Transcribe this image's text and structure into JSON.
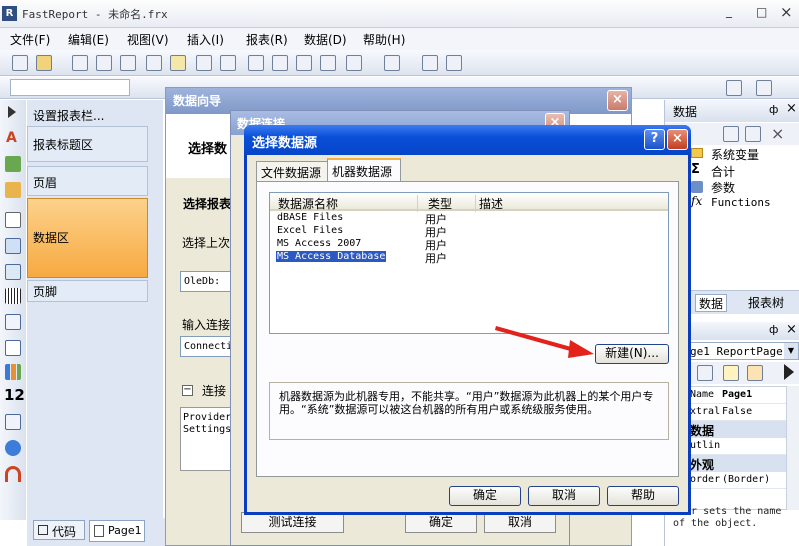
{
  "app": {
    "title": "FastReport - 未命名.frx",
    "win_min": "_",
    "win_max": "□",
    "win_close": "×"
  },
  "menu": [
    {
      "label": "文件(F)"
    },
    {
      "label": "编辑(E)"
    },
    {
      "label": "视图(V)"
    },
    {
      "label": "插入(I)"
    },
    {
      "label": "报表(R)"
    },
    {
      "label": "数据(D)"
    },
    {
      "label": "帮助(H)"
    }
  ],
  "bands": {
    "setup": "设置报表栏...",
    "items": [
      {
        "label": "报表标题区"
      },
      {
        "label": "页眉"
      },
      {
        "label": "数据区"
      },
      {
        "label": "页脚"
      }
    ]
  },
  "bottom_tabs": {
    "code": "代码",
    "page": "Page1"
  },
  "wizard": {
    "title": "数据向导",
    "heading": "选择数",
    "step_label": "选择报表",
    "upper_label": "选择上次",
    "oledb_value": "OleDb: ",
    "conn_label": "输入连接",
    "conn_value": "Connecti",
    "connect_section": "连接",
    "provider_text": "Provider",
    "settings_text": "Settings",
    "close": "×"
  },
  "conn_dialog": {
    "title": "数据连接",
    "close": "×",
    "test_button": "测试连接",
    "ok": "确定",
    "cancel": "取消"
  },
  "source_dialog": {
    "title": "选择数据源",
    "help": "?",
    "close": "×",
    "tabs": [
      {
        "label": "文件数据源"
      },
      {
        "label": "机器数据源"
      }
    ],
    "columns": {
      "name": "数据源名称",
      "type": "类型",
      "desc": "描述"
    },
    "rows": [
      {
        "name": "dBASE Files",
        "type": "用户"
      },
      {
        "name": "Excel Files",
        "type": "用户"
      },
      {
        "name": "MS Access 2007",
        "type": "用户"
      },
      {
        "name": "MS Access Database",
        "type": "用户"
      }
    ],
    "new_button": "新建(N)...",
    "description": "机器数据源为此机器专用，不能共享。“用户”数据源为此机器上的某个用户专用。“系统”数据源可以被这台机器的所有用户或系统级服务使用。",
    "ok": "确定",
    "cancel": "取消",
    "help_button": "帮助"
  },
  "data_panel": {
    "title": "数据",
    "pin": "ф",
    "close": "×",
    "tree": [
      {
        "label": "系统变量"
      },
      {
        "label": "合计"
      },
      {
        "label": "参数"
      },
      {
        "label": "Functions"
      }
    ],
    "tab_data": "数据",
    "tab_tree": "报表树"
  },
  "props_panel": {
    "pin": "ф",
    "close": "×",
    "object": "ge1 ReportPage",
    "rows": [
      {
        "name": "Name",
        "value": "Page1",
        "bold": true
      },
      {
        "name": "xtral",
        "value": "False"
      },
      {
        "name": "数据",
        "value": "",
        "cat": true
      },
      {
        "name": "utlin",
        "value": ""
      },
      {
        "name": "外观",
        "value": "",
        "cat": true
      },
      {
        "name": "order",
        "value": "(Border)"
      },
      {
        "name": "",
        "value": ""
      }
    ],
    "desc": "s or sets the name of the object."
  },
  "colors": {
    "title_bar": "#2d5ec8",
    "selection": "#2b58c1",
    "band_active": "#f8b552",
    "arrow": "#e3221b",
    "dialog_bg": "#ece9d8"
  }
}
